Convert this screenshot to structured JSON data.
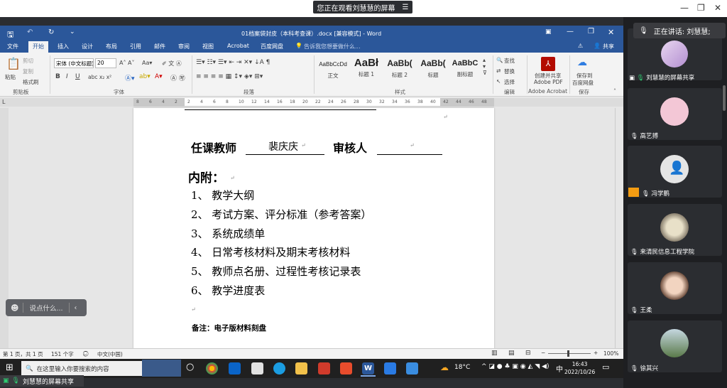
{
  "meeting": {
    "share_banner": "您正在观看刘慧慧的屏幕",
    "speaking_now": "正在讲话: 刘慧慧;",
    "bottom_label": "刘慧慧的屏幕共享",
    "participants": [
      {
        "name": "刘慧慧的屏幕共享"
      },
      {
        "name": "高艺搏"
      },
      {
        "name": "冯学鹏"
      },
      {
        "name": "来清民信息工程学院"
      },
      {
        "name": "王柔"
      },
      {
        "name": "徐其兴"
      }
    ]
  },
  "word": {
    "title": "01档案袋封皮（本科考查课）.docx [兼容模式] - Word",
    "menu": [
      "文件",
      "开始",
      "插入",
      "设计",
      "布局",
      "引用",
      "邮件",
      "审阅",
      "视图",
      "Acrobat",
      "百度网盘"
    ],
    "tell_me": "告诉我您想要做什么...",
    "share": "共享",
    "clipboard": {
      "paste": "粘贴",
      "cut": "剪切",
      "copy": "复制",
      "format_painter": "格式刷",
      "group": "剪贴板"
    },
    "font": {
      "name": "宋体 (中文标题)",
      "size": "20",
      "group": "字体"
    },
    "paragraph_group": "段落",
    "styles": [
      {
        "sample": "AaBbCcDd",
        "label": "正文"
      },
      {
        "sample": "AaBł",
        "label": "标题 1"
      },
      {
        "sample": "AaBb(",
        "label": "标题 2"
      },
      {
        "sample": "AaBb(",
        "label": "标题"
      },
      {
        "sample": "AaBbC",
        "label": "副标题"
      }
    ],
    "styles_group": "样式",
    "editing": {
      "find": "查找",
      "replace": "替换",
      "select": "选择",
      "group": "编辑"
    },
    "acrobat": {
      "label1": "创建并共享",
      "label2": "Adobe PDF",
      "group": "Adobe Acrobat"
    },
    "baidu": {
      "label1": "保存到",
      "label2": "百度网盘",
      "group": "保存"
    },
    "ruler_numbers": [
      "8",
      "6",
      "4",
      "2",
      "2",
      "4",
      "6",
      "8",
      "10",
      "12",
      "14",
      "16",
      "18",
      "20",
      "22",
      "24",
      "26",
      "28",
      "30",
      "32",
      "34",
      "36",
      "38",
      "40",
      "42",
      "44",
      "46",
      "48"
    ]
  },
  "document": {
    "teacher_label": "任课教师",
    "teacher_name": "裴庆庆",
    "reviewer_label": "审核人",
    "attach_title": "内附：",
    "items": [
      "1、 教学大纲",
      "2、 考试方案、评分标准（参考答案）",
      "3、 系统成绩单",
      "4、 日常考核材料及期末考核材料",
      "5、 教师点名册、过程性考核记录表",
      "6、 教学进度表"
    ],
    "note": "备注：电子版材料刻盘"
  },
  "status": {
    "page": "第 1 页，共 1 页",
    "words": "151 个字",
    "lang": "中文(中国)",
    "zoom": "100%"
  },
  "taskbar": {
    "search_placeholder": "在这里输入你要搜索的内容",
    "weather": "18°C",
    "ime": "中",
    "time": "16:43",
    "date": "2022/10/26"
  },
  "chat": {
    "placeholder": "说点什么..."
  }
}
